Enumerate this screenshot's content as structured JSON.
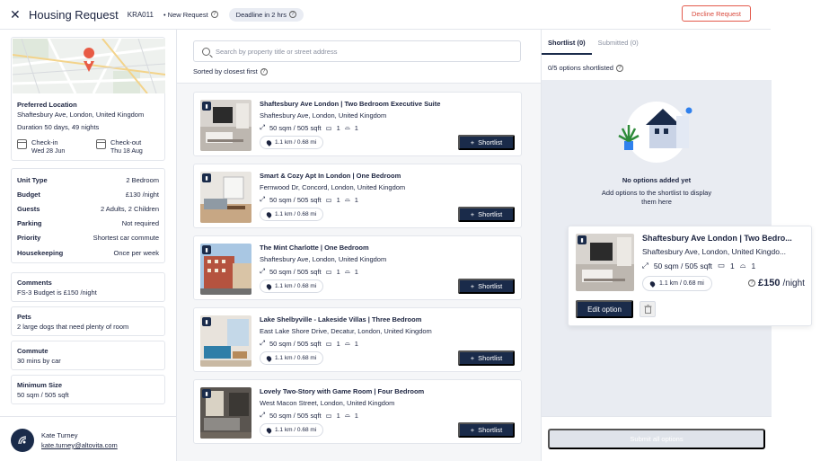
{
  "header": {
    "close": "✕",
    "title": "Housing Request",
    "ref": "KRA011",
    "status": "• New Request",
    "help": "?",
    "deadline": "Deadline in 2 hrs",
    "decline": "Decline Request"
  },
  "location": {
    "title": "Preferred Location",
    "address": "Shaftesbury Ave, London, United Kingdom",
    "duration": "Duration 50 days, 49 nights",
    "checkin_label": "Check-in",
    "checkin_date": "Wed 28 Jun",
    "checkout_label": "Check-out",
    "checkout_date": "Thu 18 Aug"
  },
  "details": [
    {
      "k": "Unit Type",
      "v": "2 Bedroom"
    },
    {
      "k": "Budget",
      "v": "£130 /night"
    },
    {
      "k": "Guests",
      "v": "2 Adults, 2 Children"
    },
    {
      "k": "Parking",
      "v": "Not required"
    },
    {
      "k": "Priority",
      "v": "Shortest car commute"
    },
    {
      "k": "Housekeeping",
      "v": "Once per week"
    }
  ],
  "notes": [
    {
      "title": "Comments",
      "value": "FS-3 Budget is £150 /night"
    },
    {
      "title": "Pets",
      "value": "2 large dogs that need plenty of room"
    },
    {
      "title": "Commute",
      "value": "30 mins by car"
    },
    {
      "title": "Minimum Size",
      "value": "50 sqm / 505 sqft"
    }
  ],
  "user": {
    "name": "Kate Turney",
    "email": "kate.turney@altovita.com"
  },
  "search": {
    "placeholder": "Search by property title or street address",
    "sort": "Sorted by closest first"
  },
  "properties": [
    {
      "title": "Shaftesbury Ave London | Two Bedroom Executive Suite",
      "address": "Shaftesbury Ave, London, United Kingdom",
      "size": "50 sqm / 505 sqft",
      "beds": "1",
      "baths": "1",
      "distance": "1.1 km / 0.68 mi",
      "button": "Shortlist"
    },
    {
      "title": "Smart & Cozy Apt In London | One Bedroom",
      "address": "Fernwood Dr, Concord, London, United Kingdom",
      "size": "50 sqm / 505 sqft",
      "beds": "1",
      "baths": "1",
      "distance": "1.1 km / 0.68 mi",
      "button": "Shortlist"
    },
    {
      "title": "The Mint Charlotte | One Bedroom",
      "address": "Shaftesbury Ave, London, United Kingdom",
      "size": "50 sqm / 505 sqft",
      "beds": "1",
      "baths": "1",
      "distance": "1.1 km / 0.68 mi",
      "button": "Shortlist"
    },
    {
      "title": "Lake Shelbyville - Lakeside Villas | Three Bedroom",
      "address": "East Lake Shore Drive, Decatur, London, United Kingdom",
      "size": "50 sqm / 505 sqft",
      "beds": "1",
      "baths": "1",
      "distance": "1.1 km / 0.68 mi",
      "button": "Shortlist"
    },
    {
      "title": "Lovely Two-Story with Game Room | Four Bedroom",
      "address": "West Macon Street, London, United Kingdom",
      "size": "50 sqm / 505 sqft",
      "beds": "1",
      "baths": "1",
      "distance": "1.1 km / 0.68 mi",
      "button": "Shortlist"
    }
  ],
  "shortlist": {
    "tab_shortlist": "Shortlist (0)",
    "tab_submitted": "Submitted (0)",
    "count": "0/5 options shortlisted",
    "empty_title": "No options added yet",
    "empty_desc": "Add options to the shortlist to display them here",
    "submit": "Submit all options"
  },
  "floating": {
    "title": "Shaftesbury Ave London | Two Bedro...",
    "address": "Shaftesbury Ave, London, United Kingdo...",
    "size": "50 sqm / 505 sqft",
    "beds": "1",
    "baths": "1",
    "distance": "1.1 km / 0.68 mi",
    "price": "£150",
    "per": "/night",
    "edit": "Edit option"
  },
  "colors": {
    "navy": "#1a2b4a",
    "decline": "#d94a3d",
    "pin": "#e85b45"
  }
}
